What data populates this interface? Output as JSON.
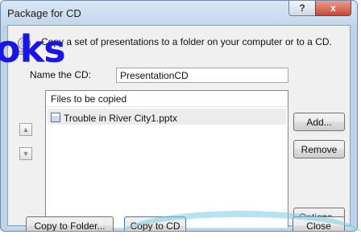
{
  "window": {
    "title": "Package for CD",
    "help_glyph": "?",
    "close_glyph": "x"
  },
  "instruction": "Copy a set of presentations to a folder on your computer or to a CD.",
  "name_label": "Name the CD:",
  "cd_name_value": "PresentationCD",
  "files": {
    "header": "Files to be copied",
    "items": [
      {
        "name": "Trouble in River City1.pptx",
        "icon": "pptx-file-icon",
        "selected": true
      }
    ]
  },
  "move_buttons": {
    "up_glyph": "▲",
    "down_glyph": "▼"
  },
  "buttons": {
    "add": "Add...",
    "remove": "Remove",
    "options": "Options...",
    "copy_to_folder": "Copy to Folder...",
    "copy_to_cd": "Copy to CD",
    "close": "Close"
  },
  "overlay_text": "oks",
  "icons": {
    "cd": "cd-icon",
    "help": "help-icon",
    "close": "close-icon",
    "up": "arrow-up-icon",
    "down": "arrow-down-icon"
  },
  "colors": {
    "overlay": "#1a14e6",
    "window_frame": "#bdd3e8",
    "close_button": "#c44b36"
  }
}
